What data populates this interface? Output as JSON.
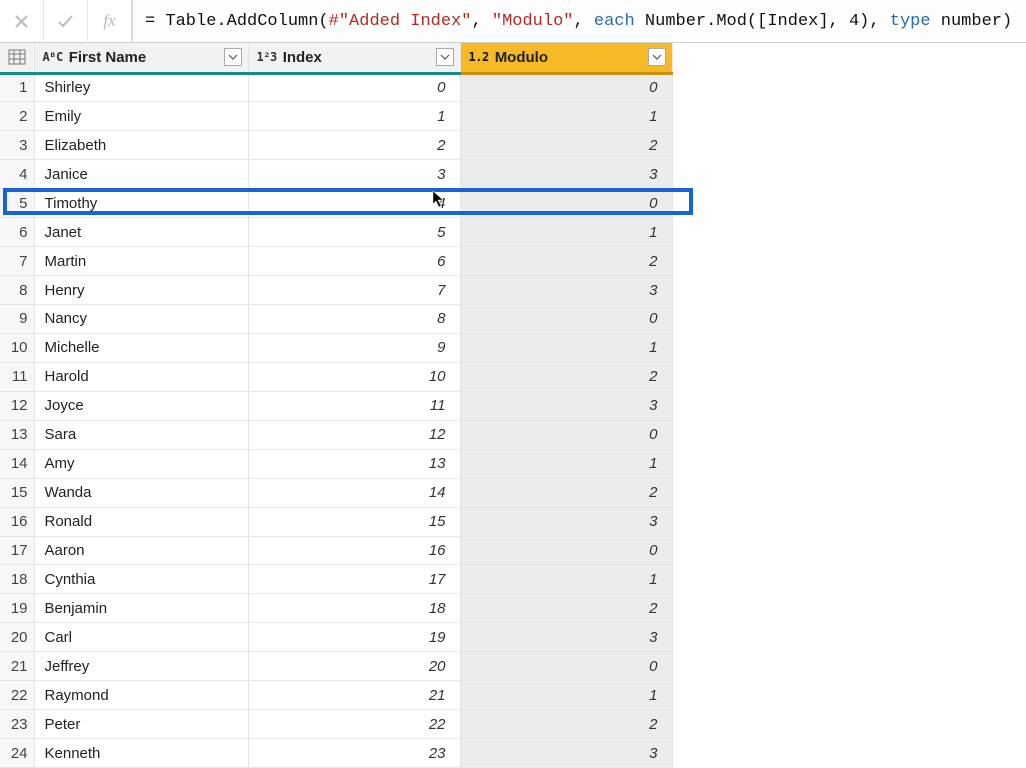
{
  "formula_bar": {
    "cancel_tooltip": "Cancel",
    "confirm_tooltip": "Confirm",
    "fx_label": "fx",
    "formula_prefix": "= Table.AddColumn(",
    "formula_arg1": "#\"Added Index\"",
    "formula_comma1": ", ",
    "formula_arg2": "\"Modulo\"",
    "formula_mid": ", ",
    "formula_each": "each",
    "formula_body": " Number.Mod([Index], 4), ",
    "formula_type": "type",
    "formula_end": " number)"
  },
  "columns": {
    "row_header": "",
    "name": {
      "type_icon": "AᴮC",
      "label": "First Name"
    },
    "index": {
      "type_icon": "1²3",
      "label": "Index"
    },
    "modulo": {
      "type_icon": "1.2",
      "label": "Modulo"
    }
  },
  "rows": [
    {
      "n": "1",
      "name": "Shirley",
      "index": "0",
      "mod": "0"
    },
    {
      "n": "2",
      "name": "Emily",
      "index": "1",
      "mod": "1"
    },
    {
      "n": "3",
      "name": "Elizabeth",
      "index": "2",
      "mod": "2"
    },
    {
      "n": "4",
      "name": "Janice",
      "index": "3",
      "mod": "3"
    },
    {
      "n": "5",
      "name": "Timothy",
      "index": "4",
      "mod": "0"
    },
    {
      "n": "6",
      "name": "Janet",
      "index": "5",
      "mod": "1"
    },
    {
      "n": "7",
      "name": "Martin",
      "index": "6",
      "mod": "2"
    },
    {
      "n": "8",
      "name": "Henry",
      "index": "7",
      "mod": "3"
    },
    {
      "n": "9",
      "name": "Nancy",
      "index": "8",
      "mod": "0"
    },
    {
      "n": "10",
      "name": "Michelle",
      "index": "9",
      "mod": "1"
    },
    {
      "n": "11",
      "name": "Harold",
      "index": "10",
      "mod": "2"
    },
    {
      "n": "12",
      "name": "Joyce",
      "index": "11",
      "mod": "3"
    },
    {
      "n": "13",
      "name": "Sara",
      "index": "12",
      "mod": "0"
    },
    {
      "n": "14",
      "name": "Amy",
      "index": "13",
      "mod": "1"
    },
    {
      "n": "15",
      "name": "Wanda",
      "index": "14",
      "mod": "2"
    },
    {
      "n": "16",
      "name": "Ronald",
      "index": "15",
      "mod": "3"
    },
    {
      "n": "17",
      "name": "Aaron",
      "index": "16",
      "mod": "0"
    },
    {
      "n": "18",
      "name": "Cynthia",
      "index": "17",
      "mod": "1"
    },
    {
      "n": "19",
      "name": "Benjamin",
      "index": "18",
      "mod": "2"
    },
    {
      "n": "20",
      "name": "Carl",
      "index": "19",
      "mod": "3"
    },
    {
      "n": "21",
      "name": "Jeffrey",
      "index": "20",
      "mod": "0"
    },
    {
      "n": "22",
      "name": "Raymond",
      "index": "21",
      "mod": "1"
    },
    {
      "n": "23",
      "name": "Peter",
      "index": "22",
      "mod": "2"
    },
    {
      "n": "24",
      "name": "Kenneth",
      "index": "23",
      "mod": "3"
    }
  ],
  "highlight": {
    "row_number": "5"
  },
  "colors": {
    "accent_teal": "#148d85",
    "selected_header": "#f6ba27",
    "highlight_border": "#1565d8"
  }
}
